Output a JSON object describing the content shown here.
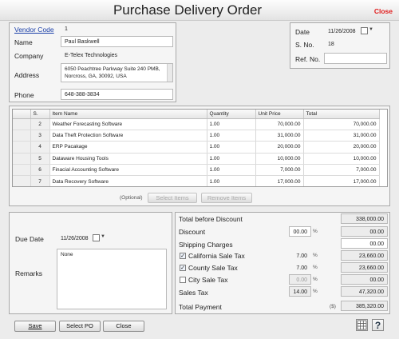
{
  "window": {
    "title": "Purchase Delivery Order",
    "close_label": "Close"
  },
  "vendor": {
    "code_label": "Vendor Code",
    "code_value": "1",
    "name_label": "Name",
    "name_value": "Paul Baskwell",
    "company_label": "Company",
    "company_value": "E-Telex Technologies",
    "address_label": "Address",
    "address_line1": "6050 Peachtree Parkway Suite 240 PMB,",
    "address_line2": "Norcross, GA, 30092, USA",
    "phone_label": "Phone",
    "phone_value": "648-388-3834"
  },
  "order": {
    "date_label": "Date",
    "date_value": "11/26/2008",
    "sno_label": "S. No.",
    "sno_value": "18",
    "ref_label": "Ref. No.",
    "ref_value": ""
  },
  "grid": {
    "columns": [
      "S.",
      "Item Name",
      "Quantity",
      "Unit Price",
      "Total"
    ],
    "rows": [
      {
        "sn": "2",
        "name": "Weather Forecasting Software",
        "qty": "1.00",
        "price": "70,000.00",
        "total": "70,000.00"
      },
      {
        "sn": "3",
        "name": "Data Theft Protection Software",
        "qty": "1.00",
        "price": "31,000.00",
        "total": "31,000.00"
      },
      {
        "sn": "4",
        "name": "ERP Pacakage",
        "qty": "1.00",
        "price": "20,000.00",
        "total": "20,000.00"
      },
      {
        "sn": "5",
        "name": "Dataware Housing Tools",
        "qty": "1.00",
        "price": "10,000.00",
        "total": "10,000.00"
      },
      {
        "sn": "6",
        "name": "Finacial Accounting Software",
        "qty": "1.00",
        "price": "7,000.00",
        "total": "7,000.00"
      },
      {
        "sn": "7",
        "name": "Data Recovery Software",
        "qty": "1.00",
        "price": "17,000.00",
        "total": "17,000.00"
      }
    ],
    "optional_label": "(Optional)",
    "select_items_label": "Select Items",
    "remove_items_label": "Remove Items"
  },
  "schedule": {
    "due_date_label": "Due Date",
    "due_date_value": "11/26/2008",
    "remarks_label": "Remarks",
    "remarks_value": "None"
  },
  "totals": {
    "before_discount_label": "Total before Discount",
    "before_discount_value": "338,000.00",
    "discount_label": "Discount",
    "discount_pct": "00.00",
    "discount_value": "00.00",
    "shipping_label": "Shipping Charges",
    "shipping_value": "00.00",
    "california_label": "California Sale Tax",
    "california_pct": "7.00",
    "california_value": "23,660.00",
    "california_checked": "✓",
    "county_label": "County Sale Tax",
    "county_pct": "7.00",
    "county_value": "23,660.00",
    "county_checked": "✓",
    "city_label": "City Sale Tax",
    "city_pct": "0.00",
    "city_value": "00.00",
    "sales_tax_label": "Sales Tax",
    "sales_tax_pct": "14.00",
    "sales_tax_value": "47,320.00",
    "total_payment_label": "Total Payment",
    "currency": "($)",
    "total_payment_value": "385,320.00",
    "percent_sign": "%"
  },
  "actions": {
    "save_label": "Save",
    "select_po_label": "Select PO",
    "close_label": "Close"
  }
}
